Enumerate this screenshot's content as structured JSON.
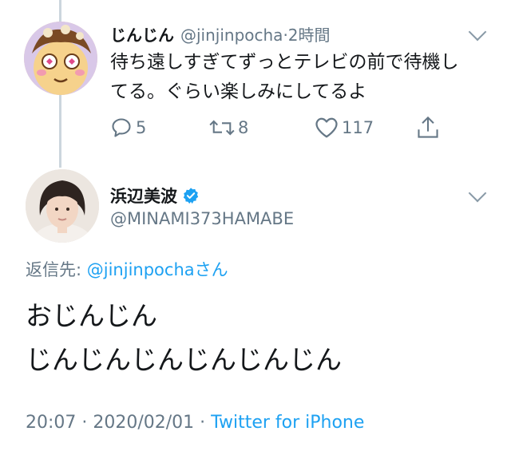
{
  "reply_tweet": {
    "display_name": "じんじん",
    "handle": "@jinjinpocha",
    "separator": "·",
    "time": "2時間",
    "text_line1": "待ち遠しすぎてずっとテレビの前で待機し",
    "text_line2": "てる。ぐらい楽しみにしてるよ",
    "replies": "5",
    "retweets": "8",
    "likes": "117",
    "icons": [
      "reply-icon",
      "retweet-icon",
      "like-icon",
      "share-icon",
      "chevron-down-icon"
    ]
  },
  "main_tweet": {
    "display_name": "浜辺美波",
    "handle": "@MINAMI373HAMABE",
    "reply_prefix": "返信先: ",
    "reply_mention": "@jinjinpocha",
    "reply_suffix": "さん",
    "text_line1": "おじんじん",
    "text_line2": "じんじんじんじんじんじん",
    "timestamp": "20:07 · 2020/02/01 · ",
    "source": "Twitter for iPhone",
    "accent_color": "#1da1f2",
    "icons": [
      "verified-badge-icon",
      "chevron-down-icon"
    ]
  }
}
